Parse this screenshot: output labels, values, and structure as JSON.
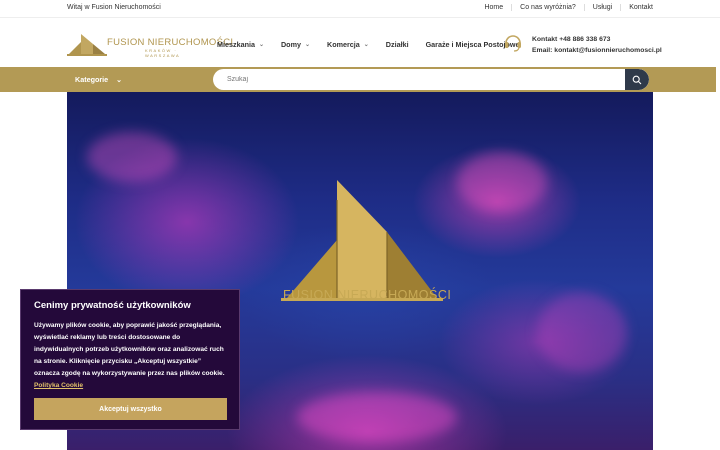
{
  "topbar": {
    "welcome": "Witaj w Fusion Nieruchomości",
    "links": [
      "Home",
      "Co nas wyróżnia?",
      "Usługi",
      "Kontakt"
    ]
  },
  "brand": {
    "name": "FUSION NIERUCHOMOŚCI",
    "sub": "KRAKÓW · WARSZAWA",
    "color": "#b0954e"
  },
  "nav": {
    "items": [
      {
        "label": "Mieszkania",
        "dropdown": true
      },
      {
        "label": "Domy",
        "dropdown": true
      },
      {
        "label": "Komercja",
        "dropdown": true
      },
      {
        "label": "Działki",
        "dropdown": false
      },
      {
        "label": "Garaże i Miejsca Postojowe",
        "dropdown": false
      }
    ]
  },
  "contact": {
    "phone": "Kontakt +48 886 338 673",
    "email": "Email: kontakt@fusionnieruchomosci.pl"
  },
  "searchbar": {
    "categories_label": "Kategorie",
    "placeholder": "Szukaj",
    "accent": "#b39a55"
  },
  "hero": {
    "logo_text": "FUSION NIERUCHOMOŚCI"
  },
  "cookie": {
    "title": "Cenimy prywatność użytkowników",
    "body": "Używamy plików cookie, aby poprawić jakość przeglądania, wyświetlać reklamy lub treści dostosowane do indywidualnych potrzeb użytkowników oraz analizować ruch na stronie. Kliknięcie przycisku „Akceptuj wszystkie” oznacza zgodę na wykorzystywanie przez nas plików cookie.",
    "policy_link": "Polityka Cookie",
    "accept_label": "Akceptuj wszystko",
    "background": "#24093a",
    "button_color": "#c5a45e"
  }
}
